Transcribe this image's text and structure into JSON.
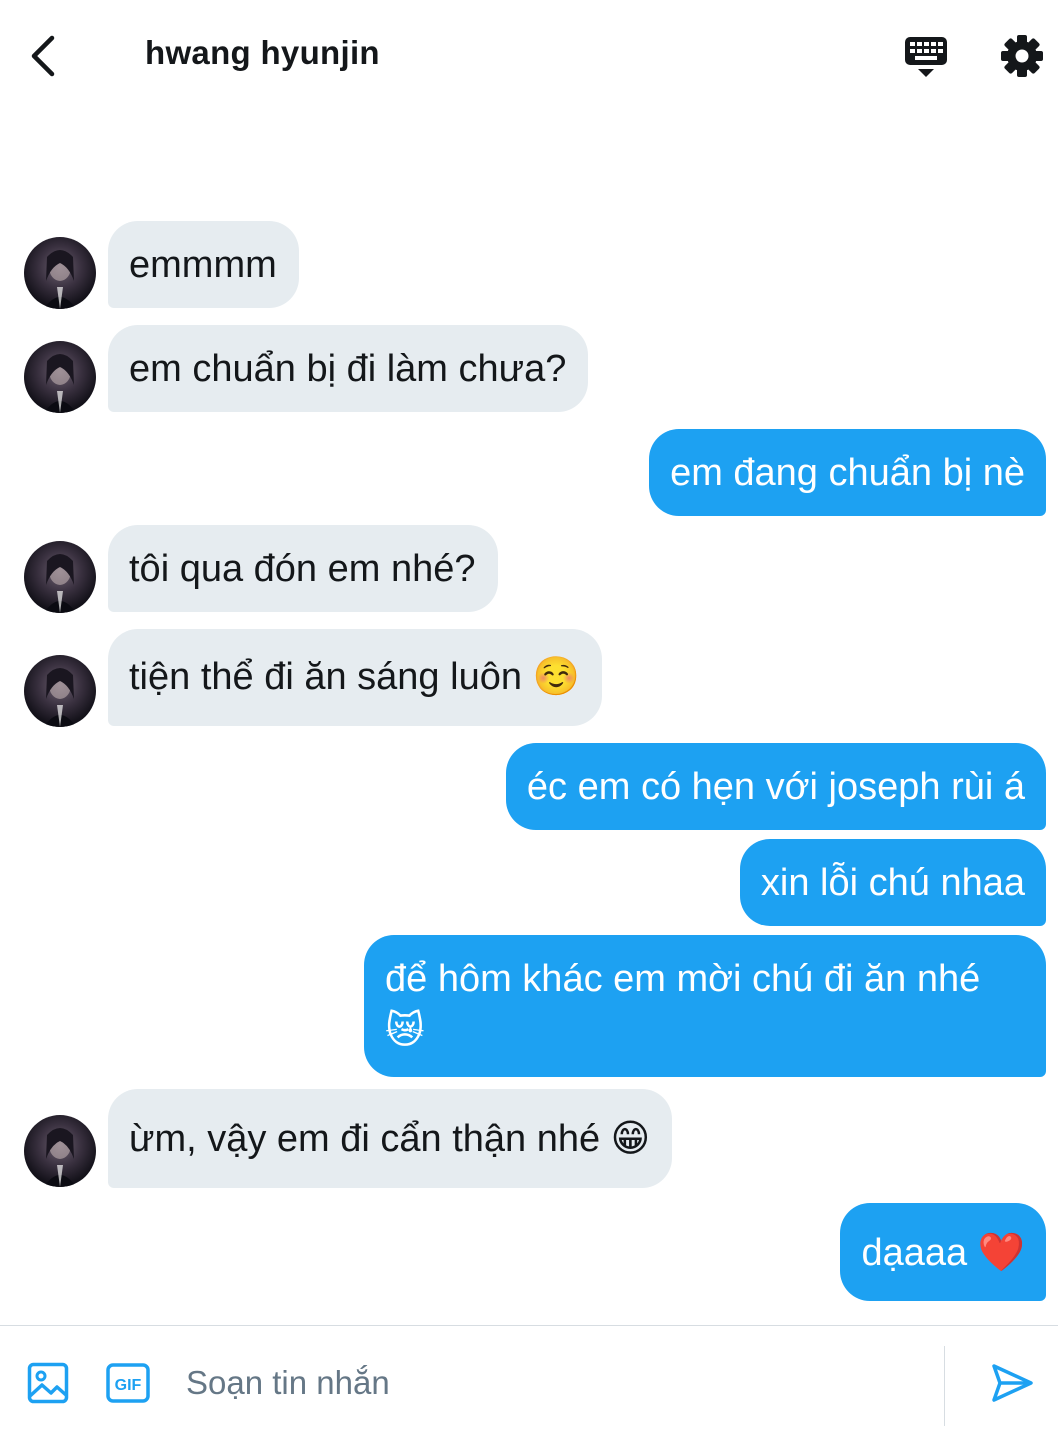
{
  "header": {
    "title": "hwang hyunjin",
    "back_icon": "chevron-left-icon",
    "keyboard_icon": "keyboard-icon",
    "settings_icon": "gear-icon"
  },
  "messages": [
    {
      "direction": "incoming",
      "text": "emmmm"
    },
    {
      "direction": "incoming",
      "text": "em chuẩn bị đi làm chưa?"
    },
    {
      "direction": "outgoing",
      "text": "em đang chuẩn bị nè"
    },
    {
      "direction": "incoming",
      "text": "tôi qua đón em nhé?"
    },
    {
      "direction": "incoming",
      "text": "tiện thể đi ăn sáng luôn ☺️"
    },
    {
      "direction": "outgoing",
      "text": "éc em có hẹn với joseph rùi á"
    },
    {
      "direction": "outgoing",
      "text": "xin lỗi chú nhaa"
    },
    {
      "direction": "outgoing",
      "text": "để hôm khác em mời chú đi ăn nhé 😿"
    },
    {
      "direction": "incoming",
      "text": "ừm, vậy em đi cẩn thận nhé 😁"
    },
    {
      "direction": "outgoing",
      "text": "dạaaa ❤️"
    }
  ],
  "composer": {
    "placeholder": "Soạn tin nhắn",
    "gif_label": "GIF",
    "media_icon": "image-icon",
    "send_icon": "send-icon"
  },
  "colors": {
    "accent": "#1da1f2",
    "incoming_bubble": "#e6ecf0",
    "text": "#14171a",
    "placeholder": "#657786"
  }
}
